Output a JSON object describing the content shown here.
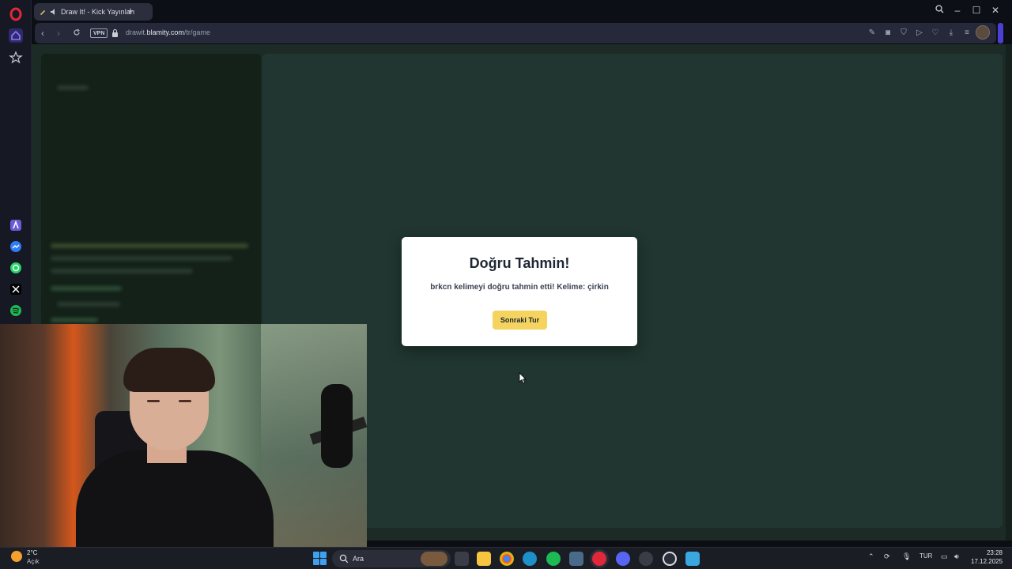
{
  "browser": {
    "tab_title": "Draw It! - Kick Yayınları",
    "url_prefix": "drawit.",
    "url_domain": "blamity.com",
    "url_path": "/tr/game",
    "vpn_label": "VPN"
  },
  "modal": {
    "title": "Doğru Tahmin!",
    "message": "brkcn kelimeyi doğru tahmin etti! Kelime: çirkin",
    "button_label": "Sonraki Tur"
  },
  "taskbar": {
    "weather_temp": "2°C",
    "weather_desc": "Açık",
    "search_placeholder": "Ara",
    "language": "TUR",
    "time": "23:28",
    "date": "17.12.2025"
  },
  "colors": {
    "accent_yellow": "#f4d35e",
    "opera_red": "#e0283a",
    "page_bg": "#1c2b26"
  }
}
